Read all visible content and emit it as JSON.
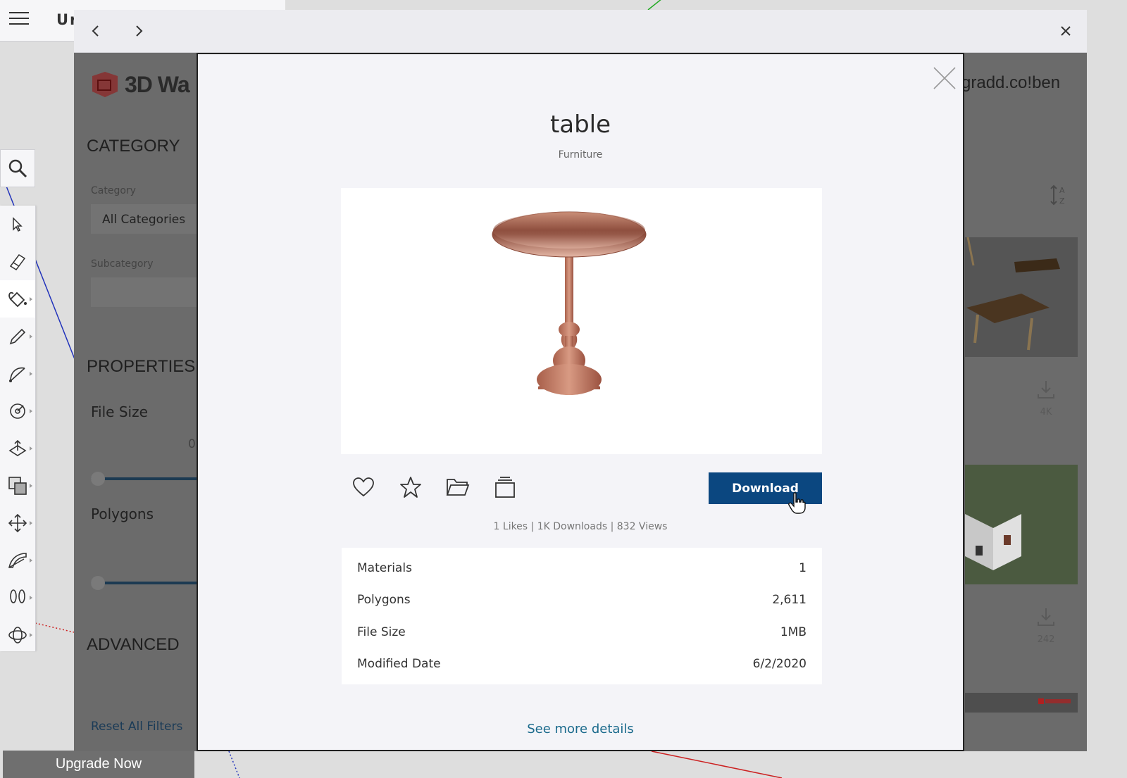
{
  "sketchup": {
    "title": "Ur",
    "upgrade_label": "Upgrade Now",
    "tools": [
      "select-tool",
      "eraser-tool",
      "paint-bucket-tool",
      "pencil-tool",
      "arc-tool",
      "rotate-tool",
      "push-pull-tool",
      "offset-tool",
      "move-tool",
      "protractor-tool",
      "walk-tool",
      "orbit-tool"
    ]
  },
  "warehouse": {
    "logo_text": "3D Wa",
    "user": "gradd.co!ben",
    "sidebar": {
      "category_heading": "CATEGORY",
      "category_label": "Category",
      "category_value": "All Categories",
      "subcategory_label": "Subcategory",
      "properties_heading": "PROPERTIES",
      "file_size_label": "File Size",
      "file_size_min": "0",
      "polygons_label": "Polygons",
      "advanced_heading": "ADVANCED",
      "reset_label": "Reset All Filters"
    },
    "results": {
      "sort_icon": "sort-az-icon",
      "card1_count": "4K",
      "card2_count": "242"
    }
  },
  "modal": {
    "title": "table",
    "category": "Furniture",
    "download_label": "Download",
    "stats": "1 Likes | 1K Downloads | 832 Views",
    "details": [
      {
        "label": "Materials",
        "value": "1"
      },
      {
        "label": "Polygons",
        "value": "2,611"
      },
      {
        "label": "File Size",
        "value": "1MB"
      },
      {
        "label": "Modified Date",
        "value": "6/2/2020"
      }
    ],
    "see_more_label": "See more details"
  },
  "colors": {
    "download_button": "#0b4780",
    "link": "#1a6a8c",
    "overlay": "#6b6b6b"
  }
}
